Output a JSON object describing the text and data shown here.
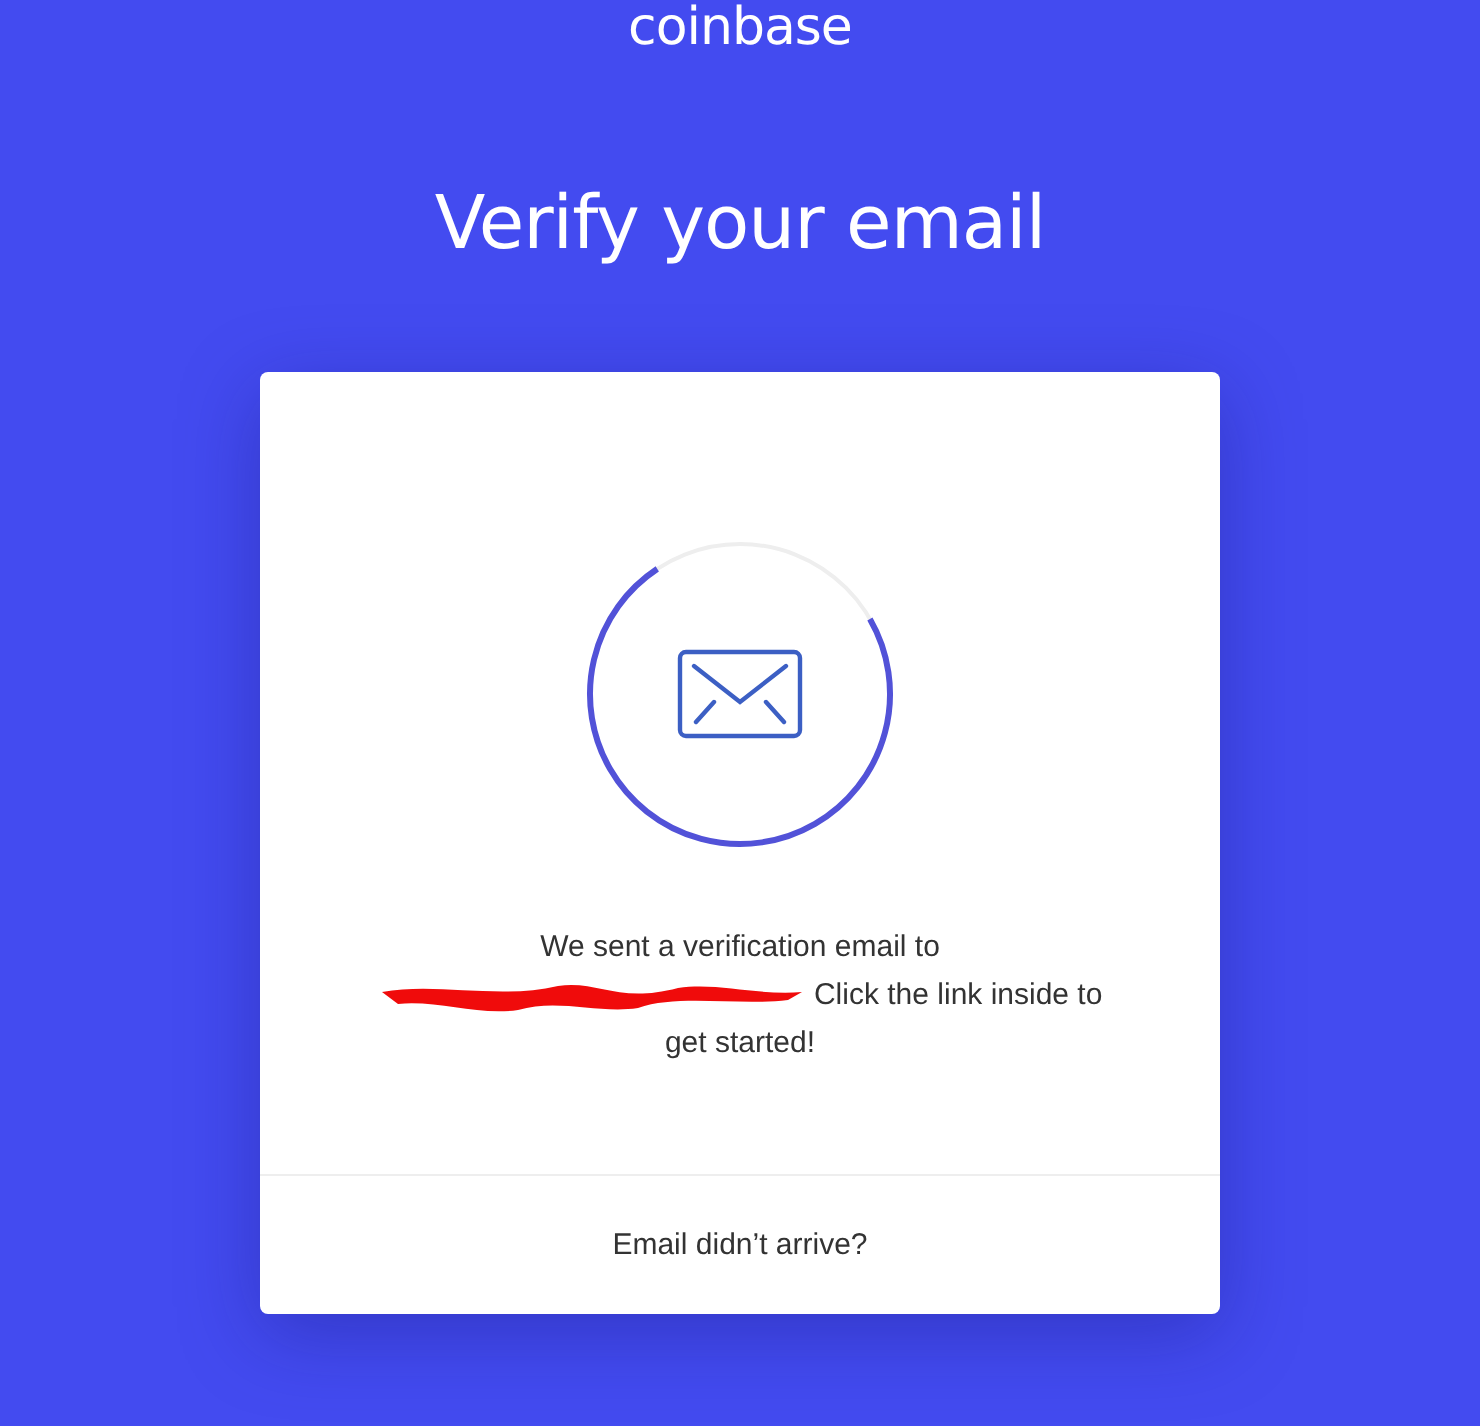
{
  "logo": {
    "text": "coinbase"
  },
  "title": "Verify your email",
  "card": {
    "message_before": "We sent a verification email to",
    "email_redacted": true,
    "message_after": "Click the link inside to get started!",
    "footer_link": "Email didn’t arrive?"
  }
}
